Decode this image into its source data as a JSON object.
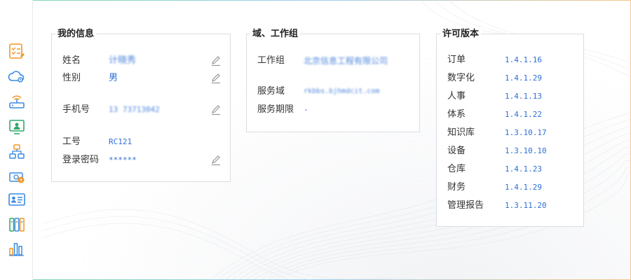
{
  "sidebar": {
    "items": [
      {
        "icon": "checklist-document-icon"
      },
      {
        "icon": "cloud-gear-icon"
      },
      {
        "icon": "router-icon"
      },
      {
        "icon": "monitor-user-icon"
      },
      {
        "icon": "org-structure-icon"
      },
      {
        "icon": "money-icon"
      },
      {
        "icon": "id-card-icon"
      },
      {
        "icon": "binders-icon"
      },
      {
        "icon": "bar-chart-icon"
      }
    ]
  },
  "my_info": {
    "title": "我的信息",
    "name_label": "姓名",
    "name_value": "计晓秀",
    "gender_label": "性别",
    "gender_value": "男",
    "phone_label": "手机号",
    "phone_value": "13 73713042",
    "job_id_label": "工号",
    "job_id_value": "RC121",
    "password_label": "登录密码",
    "password_value": "******"
  },
  "domain_group": {
    "title": "域、工作组",
    "workgroup_label": "工作组",
    "workgroup_value": "北京信息工程有限公司",
    "domain_label": "服务域",
    "domain_value": "rkbbs.bjhmdcit.com",
    "service_period_label": "服务期限",
    "service_period_value": "-"
  },
  "license": {
    "title": "许可版本",
    "items": [
      {
        "name": "订单",
        "version": "1.4.1.16"
      },
      {
        "name": "数字化",
        "version": "1.4.1.29"
      },
      {
        "name": "人事",
        "version": "1.4.1.13"
      },
      {
        "name": "体系",
        "version": "1.4.1.22"
      },
      {
        "name": "知识库",
        "version": "1.3.10.17"
      },
      {
        "name": "设备",
        "version": "1.3.10.10"
      },
      {
        "name": "仓库",
        "version": "1.4.1.23"
      },
      {
        "name": "财务",
        "version": "1.4.1.29"
      },
      {
        "name": "管理报告",
        "version": "1.3.11.20"
      }
    ]
  },
  "colors": {
    "accent_blue": "#2f6fd6",
    "icon_orange": "#f0962a",
    "icon_blue": "#3b8be0",
    "icon_green": "#2fa86a"
  }
}
